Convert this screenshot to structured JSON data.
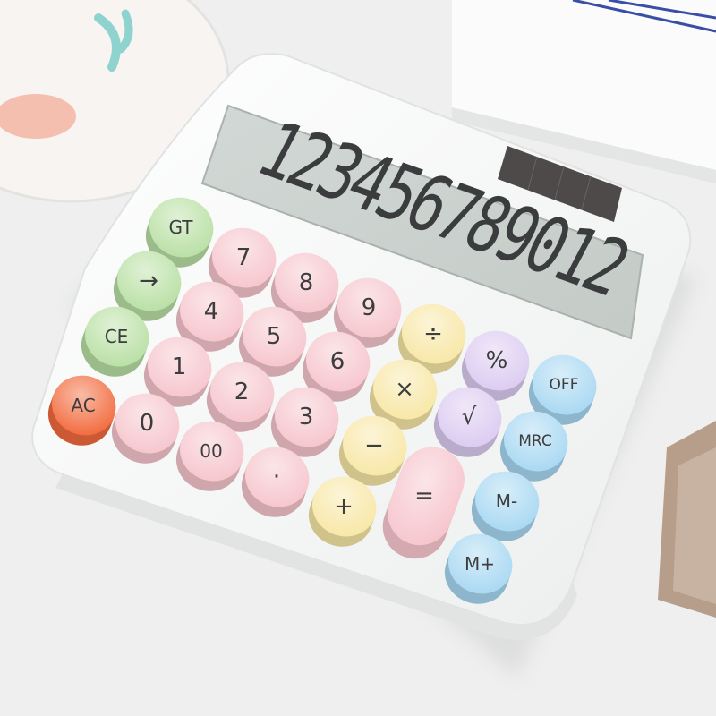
{
  "display": {
    "digits": "123456789012"
  },
  "keys": [
    {
      "id": "gt",
      "label": "GT",
      "color": "#b9e0a4"
    },
    {
      "id": "arrow",
      "label": "→",
      "color": "#b9e0a4"
    },
    {
      "id": "ce",
      "label": "CE",
      "color": "#b9e0a4"
    },
    {
      "id": "ac",
      "label": "AC",
      "color": "#f26a3d"
    },
    {
      "id": "7",
      "label": "7",
      "color": "#f6c6cd"
    },
    {
      "id": "8",
      "label": "8",
      "color": "#f6c6cd"
    },
    {
      "id": "9",
      "label": "9",
      "color": "#f6c6cd"
    },
    {
      "id": "4",
      "label": "4",
      "color": "#f6c6cd"
    },
    {
      "id": "5",
      "label": "5",
      "color": "#f6c6cd"
    },
    {
      "id": "6",
      "label": "6",
      "color": "#f6c6cd"
    },
    {
      "id": "1",
      "label": "1",
      "color": "#f6c6cd"
    },
    {
      "id": "2",
      "label": "2",
      "color": "#f6c6cd"
    },
    {
      "id": "3",
      "label": "3",
      "color": "#f6c6cd"
    },
    {
      "id": "0",
      "label": "0",
      "color": "#f6c6cd"
    },
    {
      "id": "00",
      "label": "00",
      "color": "#f6c6cd"
    },
    {
      "id": "dot",
      "label": "·",
      "color": "#f6c6cd"
    },
    {
      "id": "divide",
      "label": "÷",
      "color": "#f8e7a6"
    },
    {
      "id": "multiply",
      "label": "×",
      "color": "#f8e7a6"
    },
    {
      "id": "minus",
      "label": "−",
      "color": "#f8e7a6"
    },
    {
      "id": "plus",
      "label": "+",
      "color": "#f8e7a6"
    },
    {
      "id": "equals",
      "label": "=",
      "color": "#f6c6cd"
    },
    {
      "id": "percent",
      "label": "%",
      "color": "#dccbf1"
    },
    {
      "id": "sqrt",
      "label": "√",
      "color": "#dccbf1"
    },
    {
      "id": "off",
      "label": "OFF",
      "color": "#a8d8f2"
    },
    {
      "id": "mrc",
      "label": "MRC",
      "color": "#a8d8f2"
    },
    {
      "id": "mminus",
      "label": "M-",
      "color": "#a8d8f2"
    },
    {
      "id": "mplus",
      "label": "M+",
      "color": "#a8d8f2"
    }
  ]
}
